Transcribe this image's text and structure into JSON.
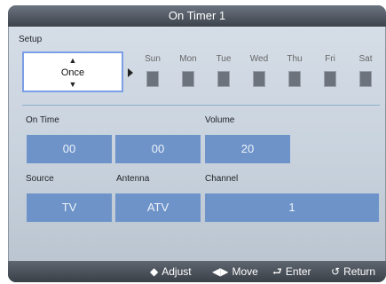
{
  "title": "On Timer 1",
  "setup": {
    "label": "Setup",
    "repeat_value": "Once",
    "up_icon": "▲",
    "down_icon": "▼"
  },
  "days": [
    {
      "label": "Sun",
      "checked": false
    },
    {
      "label": "Mon",
      "checked": false
    },
    {
      "label": "Tue",
      "checked": false
    },
    {
      "label": "Wed",
      "checked": false
    },
    {
      "label": "Thu",
      "checked": false
    },
    {
      "label": "Fri",
      "checked": false
    },
    {
      "label": "Sat",
      "checked": false
    }
  ],
  "on_time": {
    "label": "On Time",
    "hour": "00",
    "minute": "00"
  },
  "volume": {
    "label": "Volume",
    "value": "20"
  },
  "source": {
    "label": "Source",
    "value": "TV"
  },
  "antenna": {
    "label": "Antenna",
    "value": "ATV"
  },
  "channel": {
    "label": "Channel",
    "value": "1"
  },
  "hints": {
    "adjust": "Adjust",
    "move": "Move",
    "enter": "Enter",
    "return": "Return"
  },
  "colors": {
    "field": "#6d93c9",
    "selection_border": "#7c9ee6",
    "bar": "#3d434b"
  }
}
